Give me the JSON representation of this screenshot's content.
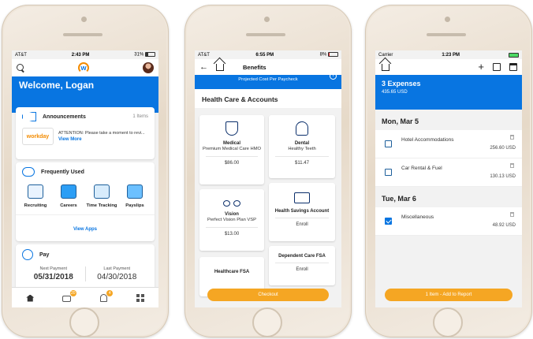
{
  "phone1": {
    "status": {
      "carrier": "AT&T",
      "time": "2:43 PM",
      "battery": "31%"
    },
    "welcome": "Welcome, Logan",
    "announcements": {
      "title": "Announcements",
      "count": "1 Items",
      "logo_text": "workday",
      "message": "ATTENTION: Please take a moment to revi...",
      "link": "View More"
    },
    "frequently_used": {
      "title": "Frequently Used",
      "items": [
        {
          "label": "Recruiting",
          "icon": "recruiting-icon"
        },
        {
          "label": "Careers",
          "icon": "briefcase-icon"
        },
        {
          "label": "Time Tracking",
          "icon": "calendar-clock-icon"
        },
        {
          "label": "Payslips",
          "icon": "wallet-icon"
        }
      ],
      "link": "View Apps"
    },
    "pay": {
      "title": "Pay",
      "next_label": "Next Payment",
      "next_value": "05/31/2018",
      "last_label": "Last Payment",
      "last_value": "04/30/2018"
    },
    "tabbar": {
      "inbox_badge": "20",
      "notifications_badge": "4"
    }
  },
  "phone2": {
    "status": {
      "carrier": "AT&T",
      "time": "6:55 PM",
      "battery": "8%"
    },
    "title": "Benefits",
    "projected": "Projected Cost Per Paycheck",
    "section": "Health Care & Accounts",
    "cards": {
      "medical": {
        "title": "Medical",
        "plan": "Premium Medical Care HMO",
        "price": "$86.00"
      },
      "dental": {
        "title": "Dental",
        "plan": "Healthy Teeth",
        "price": "$11.47"
      },
      "vision": {
        "title": "Vision",
        "plan": "Perfect Vision Plan VSP",
        "price": "$13.00"
      },
      "hsa": {
        "title": "Health Savings Account",
        "action": "Enroll"
      },
      "healthcare_fsa": {
        "title": "Healthcare FSA"
      },
      "dependent_fsa": {
        "title": "Dependent Care FSA",
        "action": "Enroll"
      }
    },
    "checkout": "Checkout"
  },
  "phone3": {
    "status": {
      "carrier": "Carrier",
      "time": "1:23 PM"
    },
    "expenses_title": "3 Expenses",
    "expenses_total": "435.65 USD",
    "days": [
      {
        "label": "Mon, Mar 5"
      },
      {
        "label": "Tue, Mar 6"
      }
    ],
    "items": [
      {
        "name": "Hotel Accommodations",
        "amount": "256.60 USD",
        "checked": false
      },
      {
        "name": "Car Rental & Fuel",
        "amount": "130.13 USD",
        "checked": false
      },
      {
        "name": "Miscellaneous",
        "amount": "48.92 USD",
        "checked": true
      }
    ],
    "add_button": "1 Item - Add to Report"
  },
  "colors": {
    "brand_blue": "#0875e1",
    "accent_orange": "#f5a623",
    "phone_frame": "#efe6da"
  }
}
